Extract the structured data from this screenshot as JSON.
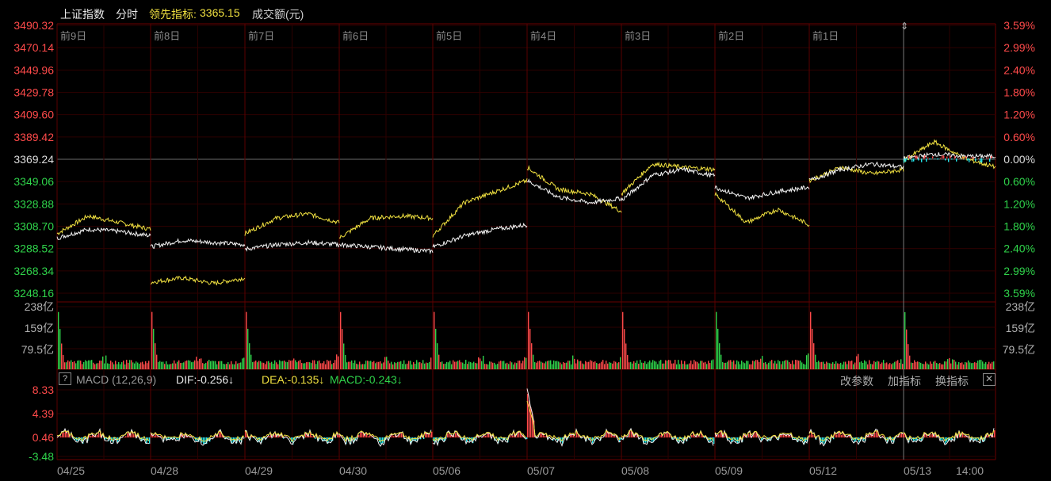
{
  "header": {
    "index_name": "上证指数",
    "period": "分时",
    "lead_label": "领先指标:",
    "lead_value": "3365.15",
    "volume_label": "成交额(元)"
  },
  "price_axis_left": [
    "3490.32",
    "3470.14",
    "3449.96",
    "3429.78",
    "3409.60",
    "3389.42",
    "3369.24",
    "3349.06",
    "3328.88",
    "3308.70",
    "3288.52",
    "3268.34",
    "3248.16"
  ],
  "price_axis_right": [
    "3.59%",
    "2.99%",
    "2.40%",
    "1.80%",
    "1.20%",
    "0.60%",
    "0.00%",
    "0.60%",
    "1.20%",
    "1.80%",
    "2.40%",
    "2.99%",
    "3.59%"
  ],
  "day_labels": [
    "前9日",
    "前8日",
    "前7日",
    "前6日",
    "前5日",
    "前4日",
    "前3日",
    "前2日",
    "前1日"
  ],
  "volume_axis": [
    "238亿",
    "159亿",
    "79.5亿"
  ],
  "macd": {
    "name": "MACD (12,26,9)",
    "dif": "DIF:-0.256↓",
    "dea": "DEA:-0.135↓",
    "macd": "MACD:-0.243↓",
    "btn_params": "改参数",
    "btn_add": "加指标",
    "btn_switch": "换指标",
    "help": "?",
    "close": "✕",
    "axis": [
      "8.33",
      "4.39",
      "0.46",
      "-3.48"
    ]
  },
  "date_axis": [
    "04/25",
    "04/28",
    "04/29",
    "04/30",
    "05/06",
    "05/07",
    "05/08",
    "05/09",
    "05/12",
    "05/13",
    "14:00"
  ],
  "colors": {
    "up": "#ff4a4a",
    "down": "#2fd34a",
    "yellow": "#f0e040",
    "white": "#f2f2f2",
    "cyan": "#22e8ee",
    "grid": "#3a0000"
  },
  "chart_data": {
    "type": "line",
    "title": "上证指数 分时",
    "series": [
      {
        "name": "领先指标",
        "values": [
          3302,
          3318,
          3312,
          3306,
          3258,
          3262,
          3257,
          3302,
          3312,
          3306,
          3300,
          3316,
          3315,
          3320,
          3340,
          3350,
          3362,
          3342,
          3330,
          3322,
          3365,
          3365,
          3355,
          3325,
          3332,
          3324,
          3350,
          3365,
          3374,
          3380,
          3370,
          3362
        ]
      },
      {
        "name": "上证指数",
        "values": [
          3298,
          3306,
          3304,
          3288,
          3292,
          3294,
          3288,
          3294,
          3292,
          3290,
          3286,
          3286,
          3300,
          3306,
          3310,
          3350,
          3335,
          3330,
          3332,
          3355,
          3360,
          3354,
          3344,
          3334,
          3340,
          3344,
          3360,
          3365,
          3374,
          3370,
          3372,
          3372
        ]
      }
    ],
    "ylim": [
      3248.16,
      3490.32
    ]
  }
}
